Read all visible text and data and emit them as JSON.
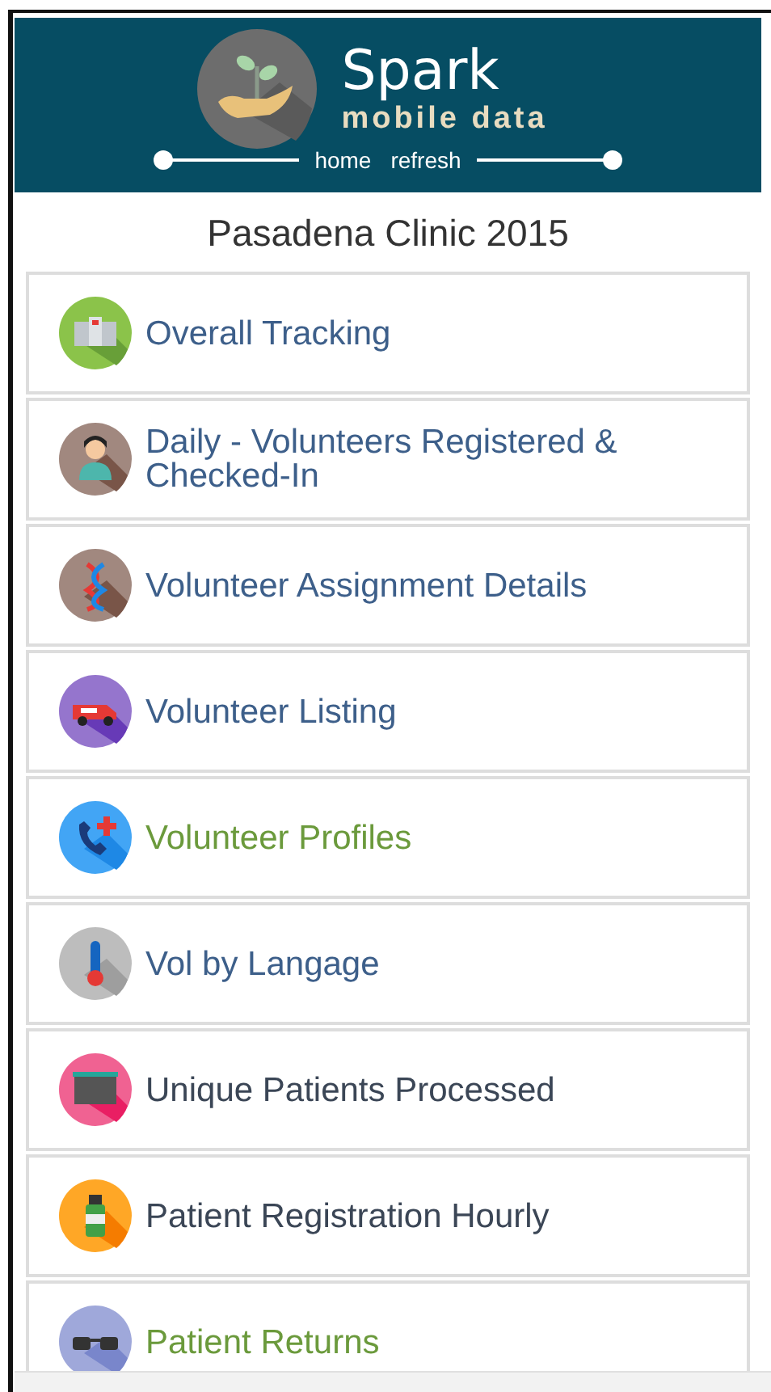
{
  "header": {
    "title": "Spark",
    "subtitle": "mobile data",
    "nav": [
      "home",
      "refresh"
    ]
  },
  "page_title": "Pasadena Clinic 2015",
  "menu": [
    {
      "label": "Overall Tracking",
      "kind": "hospital",
      "color": "#3d5f8a"
    },
    {
      "label": "Daily - Volunteers Registered & Checked-In",
      "kind": "nurse",
      "color": "#3d5f8a"
    },
    {
      "label": "Volunteer Assignment Details",
      "kind": "dna",
      "color": "#3d5f8a"
    },
    {
      "label": "Volunteer Listing",
      "kind": "ambulance",
      "color": "#3d5f8a"
    },
    {
      "label": "Volunteer Profiles",
      "kind": "phone",
      "color": "#6b9a3c"
    },
    {
      "label": "Vol by Langage",
      "kind": "thermometer",
      "color": "#3d5f8a"
    },
    {
      "label": "Unique Patients Processed",
      "kind": "board",
      "color": "#3b4656"
    },
    {
      "label": "Patient Registration Hourly",
      "kind": "bottle",
      "color": "#3b4656"
    },
    {
      "label": "Patient Returns",
      "kind": "glasses",
      "color": "#6b9a3c"
    }
  ]
}
